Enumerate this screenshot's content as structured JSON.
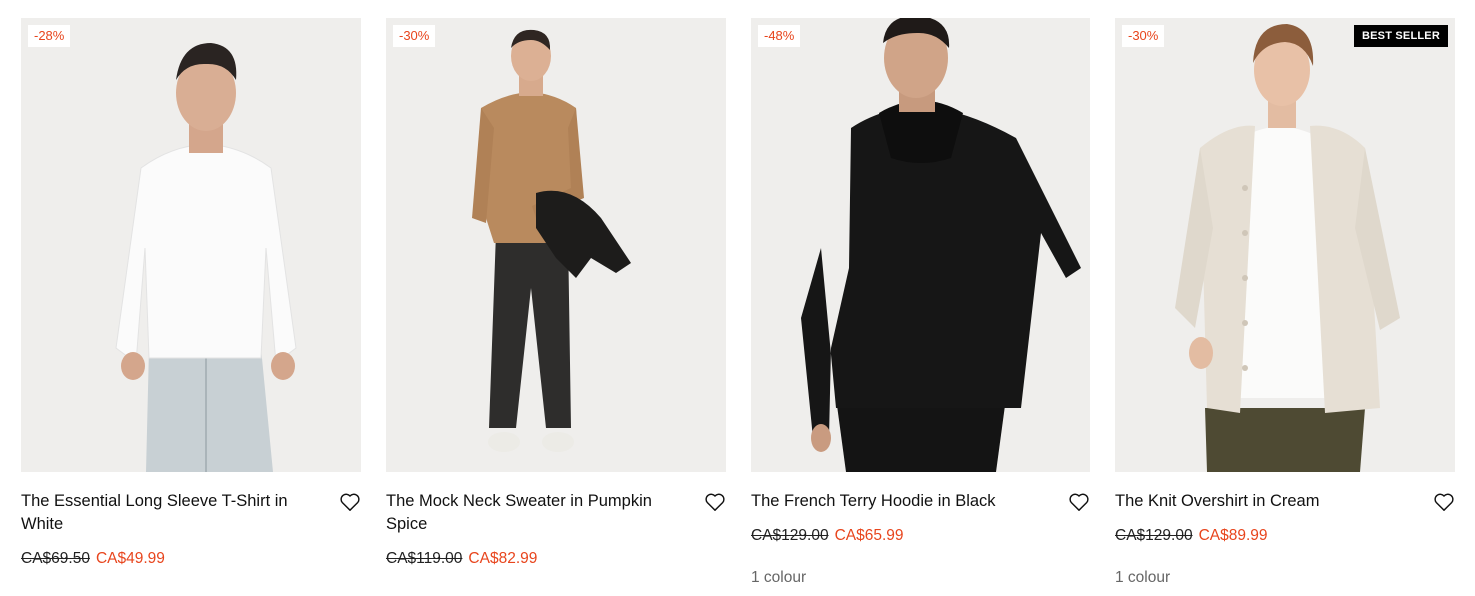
{
  "products": [
    {
      "discount": "-28%",
      "title": "The Essential Long Sleeve T-Shirt in White",
      "old_price": "CA$69.50",
      "sale_price": "CA$49.99",
      "colours": "",
      "badge": ""
    },
    {
      "discount": "-30%",
      "title": "The Mock Neck Sweater in Pumpkin Spice",
      "old_price": "CA$119.00",
      "sale_price": "CA$82.99",
      "colours": "",
      "badge": ""
    },
    {
      "discount": "-48%",
      "title": "The French Terry Hoodie in Black",
      "old_price": "CA$129.00",
      "sale_price": "CA$65.99",
      "colours": "1 colour",
      "badge": ""
    },
    {
      "discount": "-30%",
      "title": "The Knit Overshirt in Cream",
      "old_price": "CA$129.00",
      "sale_price": "CA$89.99",
      "colours": "1 colour",
      "badge": "BEST SELLER"
    }
  ],
  "colors": {
    "sale": "#e8451d",
    "photo_bg": "#efeeec",
    "badge_bg": "#000000"
  },
  "icons": {
    "wishlist": "heart-outline-icon"
  }
}
